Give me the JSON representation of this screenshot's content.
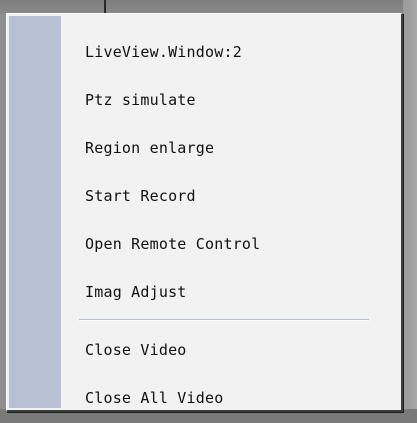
{
  "context_menu": {
    "items_top": [
      {
        "label": "LiveView.Window:2"
      },
      {
        "label": "Ptz simulate"
      },
      {
        "label": "Region enlarge"
      },
      {
        "label": "Start Record"
      },
      {
        "label": "Open Remote Control"
      },
      {
        "label": "Imag Adjust"
      }
    ],
    "items_bottom": [
      {
        "label": "Close Video"
      },
      {
        "label": "Close All Video"
      }
    ]
  },
  "colors": {
    "menu_background": "#f2f2f2",
    "gutter": "#b8c1d3",
    "separator": "#b7c0d0",
    "text": "#111111"
  }
}
